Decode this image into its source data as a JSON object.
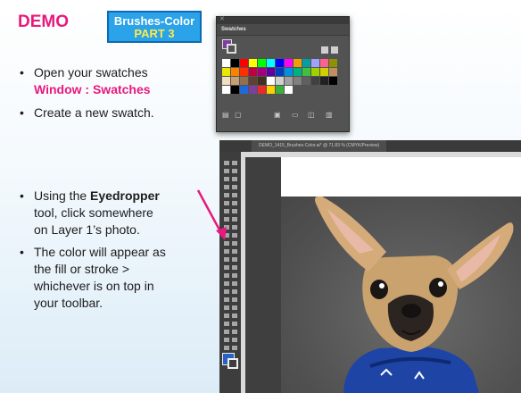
{
  "header": {
    "demo_label": "DEMO",
    "badge_line1": "Brushes-Color",
    "badge_line2": "PART 3"
  },
  "bullets": {
    "b1_line1": "Open your swatches",
    "b1_line2": "Window : Swatches",
    "b2": "Create a new swatch.",
    "b3_pre": "Using the ",
    "b3_bold": "Eyedropper",
    "b3_line2": "tool, click somewhere",
    "b3_line3": "on Layer 1’s photo.",
    "b4_line1": "The color will appear as",
    "b4_line2": "the fill or stroke >",
    "b4_line3": "whichever is on top in",
    "b4_line4": "your toolbar."
  },
  "swatches_panel": {
    "title": "Swatches",
    "close_glyph": "✕",
    "swatch_colors": [
      "#ffffff",
      "#000000",
      "#ff0000",
      "#ffff00",
      "#00ff00",
      "#00ffff",
      "#0000ff",
      "#ff00ff",
      "#f0a000",
      "#00a0a0",
      "#a0a0ff",
      "#ff6090",
      "#909000",
      "#e8e800",
      "#ff8000",
      "#ff3000",
      "#c00040",
      "#a00080",
      "#6000a0",
      "#0040c0",
      "#0090e0",
      "#00b080",
      "#40c040",
      "#a0d000",
      "#d0d000",
      "#c09060",
      "#f0e0c0",
      "#c8a070",
      "#907050",
      "#604030",
      "#403020",
      "#ffffff",
      "#d0d0d0",
      "#a0a0a0",
      "#808080",
      "#606060",
      "#404040",
      "#202020",
      "#000000",
      "#ffffff",
      "#000000",
      "#1e6ad8",
      "#7b3f9e",
      "#e82a2a",
      "#ffd000",
      "#3ab03a",
      "#ffffff"
    ],
    "colors": {
      "fill": "#7b3f9e",
      "stroke": "#535353"
    },
    "bottom_icons": [
      "library-icon",
      "swatch-options-icon",
      "group-icon",
      "new-folder-icon",
      "new-swatch-icon",
      "delete-icon"
    ]
  },
  "illustrator": {
    "doc_tab": "DEMO_1415_Brushes-Color.ai* @ 71.83 % (CMYK/Preview)",
    "fill_color": "#2a62c4"
  },
  "colors": {
    "accent": "#e8197d",
    "badge_bg": "#2aa3e8",
    "badge_text_yellow": "#ffe94d",
    "sweater_blue": "#1e44a6"
  }
}
